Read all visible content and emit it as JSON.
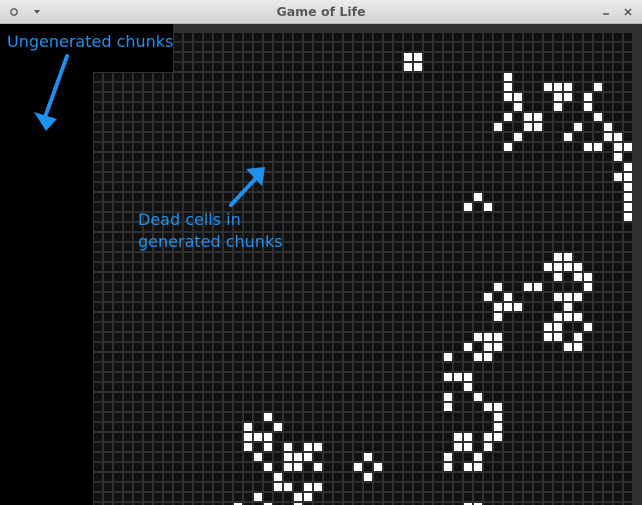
{
  "window": {
    "title": "Game of Life",
    "menu_icon": "window-menu-icon",
    "dropdown_icon": "chevron-down-icon",
    "minimize_icon": "minimize-icon",
    "close_icon": "close-icon"
  },
  "colors": {
    "ungenerated": "#000000",
    "grid_background": "#303030",
    "dead_cell": "#111111",
    "live_cell": "#ffffff",
    "annotation": "#1e90ee"
  },
  "annotations": {
    "ungenerated_label": "Ungenerated chunks",
    "dead_label_line1": "Dead cells in",
    "dead_label_line2": "generated chunks"
  },
  "board": {
    "cell_size": 10,
    "cols": 55,
    "rows": 48,
    "live_cells": [
      [
        40,
        3
      ],
      [
        41,
        3
      ],
      [
        40,
        4
      ],
      [
        41,
        4
      ],
      [
        50,
        5
      ],
      [
        50,
        6
      ],
      [
        50,
        7
      ],
      [
        51,
        7
      ],
      [
        51,
        8
      ],
      [
        52,
        9
      ],
      [
        53,
        9
      ],
      [
        52,
        10
      ],
      [
        53,
        10
      ],
      [
        54,
        6
      ],
      [
        55,
        6
      ],
      [
        56,
        6
      ],
      [
        55,
        7
      ],
      [
        56,
        7
      ],
      [
        55,
        8
      ],
      [
        59,
        6
      ],
      [
        58,
        7
      ],
      [
        58,
        8
      ],
      [
        59,
        9
      ],
      [
        60,
        10
      ],
      [
        60,
        11
      ],
      [
        61,
        11
      ],
      [
        61,
        12
      ],
      [
        62,
        12
      ],
      [
        57,
        10
      ],
      [
        56,
        11
      ],
      [
        58,
        12
      ],
      [
        59,
        12
      ],
      [
        61,
        13
      ],
      [
        62,
        14
      ],
      [
        61,
        15
      ],
      [
        62,
        15
      ],
      [
        62,
        16
      ],
      [
        62,
        17
      ],
      [
        62,
        18
      ],
      [
        62,
        19
      ],
      [
        51,
        8
      ],
      [
        50,
        9
      ],
      [
        52,
        10
      ],
      [
        49,
        10
      ],
      [
        51,
        11
      ],
      [
        50,
        12
      ],
      [
        47,
        17
      ],
      [
        46,
        18
      ],
      [
        48,
        18
      ],
      [
        55,
        23
      ],
      [
        56,
        23
      ],
      [
        54,
        24
      ],
      [
        55,
        24
      ],
      [
        56,
        24
      ],
      [
        57,
        24
      ],
      [
        55,
        25
      ],
      [
        57,
        25
      ],
      [
        58,
        25
      ],
      [
        52,
        26
      ],
      [
        53,
        26
      ],
      [
        58,
        26
      ],
      [
        49,
        26
      ],
      [
        48,
        27
      ],
      [
        50,
        27
      ],
      [
        49,
        28
      ],
      [
        50,
        28
      ],
      [
        51,
        28
      ],
      [
        49,
        29
      ],
      [
        55,
        27
      ],
      [
        56,
        27
      ],
      [
        57,
        27
      ],
      [
        56,
        28
      ],
      [
        55,
        29
      ],
      [
        56,
        29
      ],
      [
        57,
        29
      ],
      [
        54,
        30
      ],
      [
        55,
        30
      ],
      [
        58,
        30
      ],
      [
        54,
        31
      ],
      [
        55,
        31
      ],
      [
        57,
        31
      ],
      [
        56,
        32
      ],
      [
        57,
        32
      ],
      [
        47,
        31
      ],
      [
        48,
        31
      ],
      [
        49,
        31
      ],
      [
        46,
        32
      ],
      [
        48,
        32
      ],
      [
        49,
        32
      ],
      [
        47,
        33
      ],
      [
        48,
        33
      ],
      [
        44,
        33
      ],
      [
        44,
        35
      ],
      [
        45,
        35
      ],
      [
        46,
        35
      ],
      [
        46,
        36
      ],
      [
        44,
        37
      ],
      [
        44,
        38
      ],
      [
        47,
        37
      ],
      [
        48,
        38
      ],
      [
        49,
        38
      ],
      [
        49,
        39
      ],
      [
        49,
        40
      ],
      [
        48,
        41
      ],
      [
        49,
        41
      ],
      [
        45,
        41
      ],
      [
        46,
        41
      ],
      [
        45,
        42
      ],
      [
        46,
        42
      ],
      [
        44,
        43
      ],
      [
        44,
        44
      ],
      [
        47,
        43
      ],
      [
        47,
        44
      ],
      [
        48,
        42
      ],
      [
        46,
        44
      ],
      [
        26,
        39
      ],
      [
        24,
        40
      ],
      [
        27,
        40
      ],
      [
        24,
        41
      ],
      [
        25,
        41
      ],
      [
        26,
        41
      ],
      [
        24,
        42
      ],
      [
        26,
        42
      ],
      [
        28,
        42
      ],
      [
        30,
        42
      ],
      [
        31,
        42
      ],
      [
        25,
        43
      ],
      [
        28,
        43
      ],
      [
        29,
        43
      ],
      [
        30,
        43
      ],
      [
        26,
        44
      ],
      [
        29,
        44
      ],
      [
        31,
        44
      ],
      [
        27,
        45
      ],
      [
        28,
        44
      ],
      [
        28,
        46
      ],
      [
        27,
        46
      ],
      [
        30,
        46
      ],
      [
        31,
        46
      ],
      [
        29,
        47
      ],
      [
        30,
        47
      ],
      [
        36,
        43
      ],
      [
        35,
        44
      ],
      [
        37,
        44
      ],
      [
        36,
        45
      ],
      [
        23,
        48
      ],
      [
        25,
        47
      ],
      [
        26,
        48
      ],
      [
        29,
        48
      ],
      [
        46,
        48
      ],
      [
        47,
        48
      ]
    ]
  }
}
